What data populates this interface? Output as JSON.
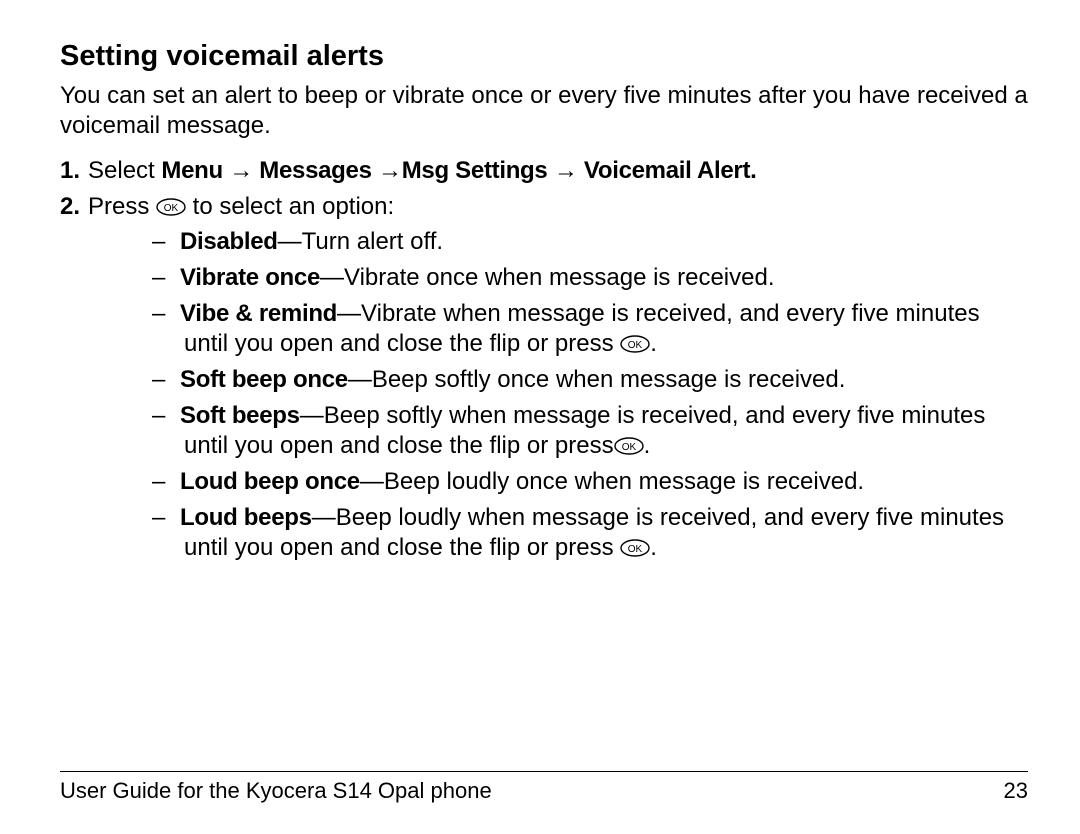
{
  "heading": "Setting voicemail alerts",
  "intro": "You can set an alert to beep or vibrate once or every five minutes after you have received a voicemail message.",
  "step1": {
    "num": "1.",
    "prefix": "Select ",
    "path_parts": [
      "Menu",
      "Messages",
      "Msg Settings",
      "Voicemail Alert."
    ],
    "arrow": "→"
  },
  "step2": {
    "num": "2.",
    "before_icon": "Press ",
    "after_icon": " to select an option:"
  },
  "options": [
    {
      "label": "Disabled",
      "desc": "—Turn alert off."
    },
    {
      "label": "Vibrate once",
      "desc": "—Vibrate once when message is received."
    },
    {
      "label": "Vibe & remind",
      "desc_before": "—Vibrate when message is received, and every five minutes until you open and close the flip or press ",
      "desc_after": "."
    },
    {
      "label": "Soft beep once",
      "desc": "—Beep softly once when message is received."
    },
    {
      "label": "Soft beeps",
      "desc_before": "—Beep softly when message is received, and every five minutes until you open and close the flip or press",
      "desc_after": "."
    },
    {
      "label": "Loud beep once",
      "desc": "—Beep loudly once when message is received."
    },
    {
      "label": "Loud beeps",
      "desc_before": "—Beep loudly when message is received, and every five minutes until you open and close the flip or press ",
      "desc_after": "."
    }
  ],
  "footer": {
    "left": "User Guide for the Kyocera S14 Opal phone",
    "right": "23"
  },
  "dash": "–"
}
